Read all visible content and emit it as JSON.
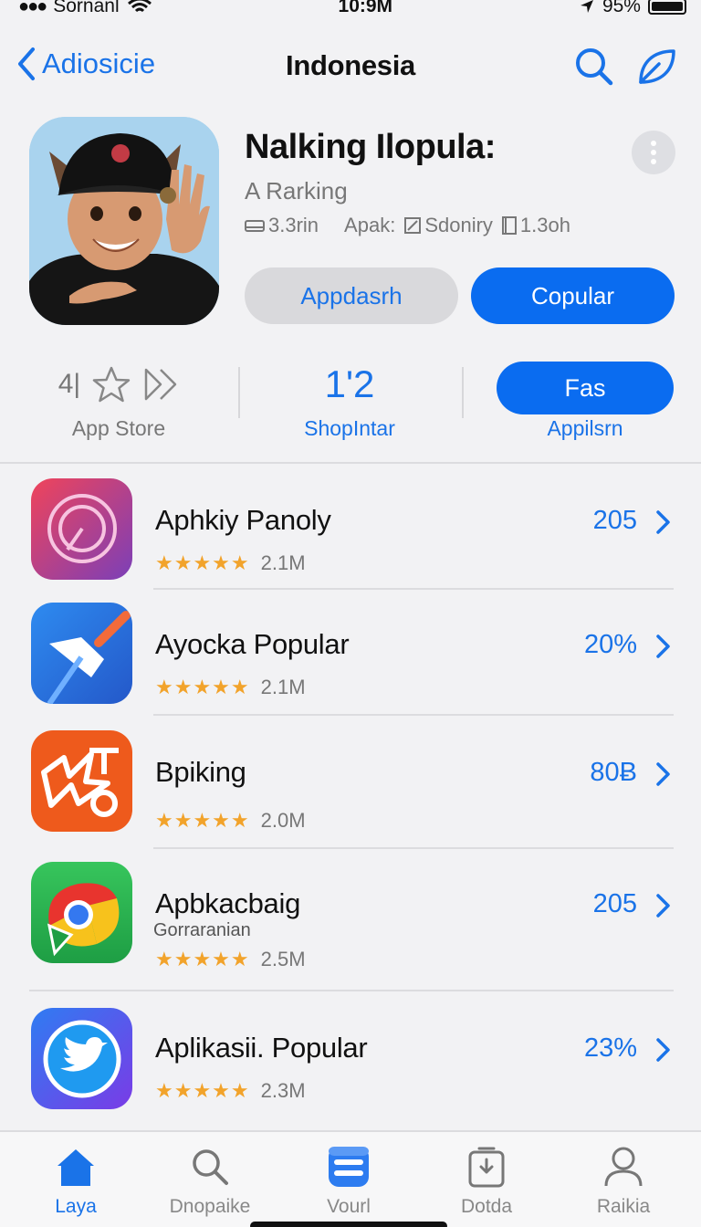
{
  "status_bar": {
    "signal": "●●●",
    "carrier": "Sornanl",
    "time": "10:9M",
    "battery": "95%"
  },
  "nav": {
    "back_label": "Adiosicie",
    "title": "Indonesia"
  },
  "hero": {
    "title": "Nalking Ilopula:",
    "subtitle": "A Rarking",
    "meta": [
      {
        "icon": "tray-icon",
        "text": "3.3rin"
      },
      {
        "icon": "",
        "text": "Apak:"
      },
      {
        "icon": "edit-icon",
        "text": "Sdoniry"
      },
      {
        "icon": "doc-icon",
        "text": "1.3oh"
      }
    ],
    "button_secondary": "Appdasrh",
    "button_primary": "Copular"
  },
  "stats": {
    "col1_number": "4|",
    "col1_label": "App Store",
    "col2_value": "1'2",
    "col2_label": "ShopIntar",
    "col3_button": "Fas",
    "col3_label": "Appilsrn"
  },
  "list": [
    {
      "name": "Aphkiy Panoly",
      "subname": "",
      "stars": "★★★★★",
      "count": "2.1M",
      "value": "205"
    },
    {
      "name": "Ayocka Popular",
      "subname": "",
      "stars": "★★★★★",
      "count": "2.1M",
      "value": "20%"
    },
    {
      "name": "Bpiking",
      "subname": "",
      "stars": "★★★★★",
      "count": "2.0M",
      "value": "80Ƀ"
    },
    {
      "name": "Apbkacbaig",
      "subname": "Gorraranian",
      "stars": "★★★★★",
      "count": "2.5M",
      "value": "205"
    },
    {
      "name": "Aplikasii. Popular",
      "subname": "",
      "stars": "★★★★★",
      "count": "2.3M",
      "value": "23%"
    }
  ],
  "tabs": [
    {
      "label": "Laya",
      "icon": "home-icon"
    },
    {
      "label": "Dnopaike",
      "icon": "search-icon"
    },
    {
      "label": "Vourl",
      "icon": "apps-icon"
    },
    {
      "label": "Dotda",
      "icon": "updates-icon"
    },
    {
      "label": "Raikia",
      "icon": "person-icon"
    }
  ],
  "colors": {
    "accent": "#1a73e8",
    "primary_button": "#0a6cf0",
    "star": "#f2a32b",
    "background": "#f2f2f4"
  }
}
